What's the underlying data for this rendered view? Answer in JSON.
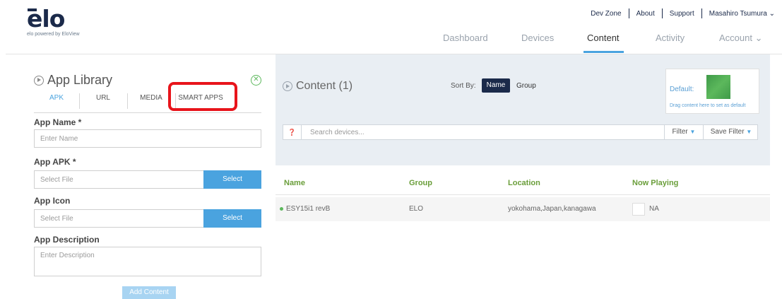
{
  "brand": {
    "logo": "elo",
    "tagline": "elo powered by EloView"
  },
  "top_links": {
    "dev_zone": "Dev Zone",
    "about": "About",
    "support": "Support",
    "user": "Masahiro Tsumura ⌄"
  },
  "nav": {
    "dashboard": "Dashboard",
    "devices": "Devices",
    "content": "Content",
    "activity": "Activity",
    "account": "Account ⌄"
  },
  "library": {
    "title": "App Library",
    "tabs": [
      "APK",
      "URL",
      "MEDIA",
      "SMART APPS"
    ],
    "app_name_label": "App Name *",
    "app_name_placeholder": "Enter Name",
    "app_apk_label": "App APK *",
    "app_apk_placeholder": "Select File",
    "app_icon_label": "App Icon",
    "app_icon_placeholder": "Select File",
    "select_label": "Select",
    "app_desc_label": "App Description",
    "app_desc_placeholder": "Enter Description",
    "add_button": "Add Content"
  },
  "content": {
    "title": "Content (1)",
    "sort_by": "Sort By:",
    "sort_name": "Name",
    "sort_group": "Group",
    "default_label": "Default:",
    "default_hint": "Drag content here to set as default",
    "search_placeholder": "Search devices...",
    "filter": "Filter",
    "save_filter": "Save Filter",
    "columns": [
      "Name",
      "Group",
      "Location",
      "Now Playing"
    ],
    "rows": [
      {
        "name": "ESY15i1 revB",
        "group": "ELO",
        "location": "yokohama,Japan,kanagawa",
        "now_playing": "NA"
      }
    ]
  },
  "colors": {
    "accent": "#4aa3df",
    "brand": "#1b2a4a",
    "highlight": "#e8141b",
    "header_green": "#6a9e3a",
    "status_online": "#5cb85c"
  }
}
